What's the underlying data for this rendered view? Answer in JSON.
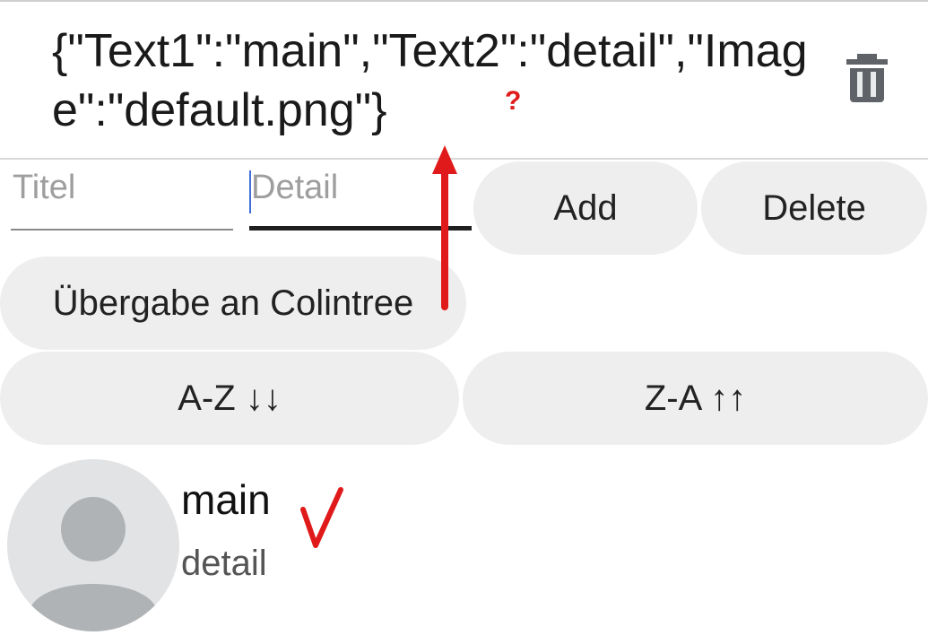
{
  "header": {
    "json_text": "{\"Text1\":\"main\",\"Text2\":\"detail\",\"Image\":\"default.png\"}",
    "trash_icon": "trash-icon"
  },
  "inputs": {
    "title_placeholder": "Titel",
    "detail_placeholder": "Detail"
  },
  "buttons": {
    "add": "Add",
    "delete": "Delete",
    "handover": "Übergabe an Colintree",
    "sort_az": "A-Z ↓↓",
    "sort_za": "Z-A ↑↑"
  },
  "list": {
    "items": [
      {
        "title": "main",
        "detail": "detail",
        "image": "avatar-placeholder-icon"
      }
    ]
  },
  "annotations": {
    "question_mark": "?",
    "color": "#e01a1a"
  }
}
